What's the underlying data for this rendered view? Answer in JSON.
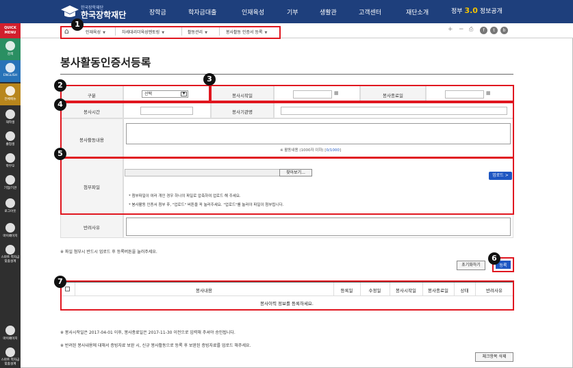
{
  "header": {
    "logo_small": "한국장학재단",
    "logo_text": "한국장학재단",
    "nav": [
      "장학금",
      "학자금대출",
      "인재육성",
      "기부",
      "생활관",
      "고객센터",
      "재단소개"
    ],
    "gov_prefix": "정부",
    "gov_num": "3.0",
    "gov_suffix": "정보공개"
  },
  "sidebar": {
    "quick_menu": "QUICK MENU",
    "items": [
      {
        "label": "검색",
        "icon": "search-icon",
        "color": "#2a8f62"
      },
      {
        "label": "ENGLISH",
        "icon": "globe-icon",
        "color": "#2873b8"
      },
      {
        "label": "전체메뉴",
        "icon": "compass-icon",
        "color": "#b8861c"
      },
      {
        "label": "재학생",
        "icon": "book-icon",
        "color": "#2f2f2f"
      },
      {
        "label": "졸업생",
        "icon": "graduation-cap-icon",
        "color": "#2f2f2f"
      },
      {
        "label": "학부모",
        "icon": "people-icon",
        "color": "#2f2f2f"
      },
      {
        "label": "기업/기관",
        "icon": "building-icon",
        "color": "#2f2f2f"
      },
      {
        "label": "로그아웃",
        "icon": "logout-icon",
        "color": "#2f2f2f"
      },
      {
        "label": "마이페이지",
        "icon": "mypage-icon",
        "color": "#2f2f2f"
      },
      {
        "label": "스마트 학자금 맞춤설계",
        "icon": "smart-icon",
        "color": "#2f2f2f"
      }
    ],
    "bottom": [
      {
        "label": "마이페이지",
        "icon": "mypage-icon"
      },
      {
        "label": "스마트 학자금 맞춤설계",
        "icon": "smart-icon"
      }
    ]
  },
  "breadcrumb": [
    "인재육성",
    "차세대리더육성멘토링",
    "활동관리",
    "봉사활동 인증서 등록"
  ],
  "page_title": "봉사활동인증서등록",
  "form": {
    "type_label": "구분",
    "type_value": "선택",
    "start_label": "봉사시작일",
    "end_label": "봉사종료일",
    "hours_label": "봉사시간",
    "org_label": "봉사기관명",
    "content_label": "봉사활동내용",
    "content_counter_prefix": "※ 활동내용 (1000자 이하) [",
    "content_counter_value": "0/1000",
    "content_counter_suffix": "]",
    "file_label": "첨부파일",
    "browse_button": "찾아보기...",
    "upload_button": "업로드 >",
    "file_note1": "* 첨부파일이 여러 개인 경우 하나의 파일로 압축하여 업로드 해 주세요.",
    "file_note2": "* 봉사활동 인증서 첨부 후, \"업로드\" 버튼을 꼭 눌러주세요. \"업로드\"를 눌러야 파일이 첨부됩니다.",
    "reject_label": "반려사유"
  },
  "upload_notice": "※ 파일 첨부시 반드시 업로드 후 등록버튼을 눌러주세요.",
  "reset_button": "초기화하기",
  "register_button": "등록",
  "list": {
    "headers": [
      "봉사내용",
      "등록일",
      "수정일",
      "봉사시작일",
      "봉사종료일",
      "상태",
      "반려사유"
    ],
    "empty_message": "봉사이력 정보를 등록하세요."
  },
  "footnotes": [
    "※ 봉사시작일은 2017-04-01 이후, 봉사종료일은 2017-11-30 이전으로 입력해 주셔야 승인됩니다.",
    "※ 반려된 봉사내용에 대해서 증빙자료 보완 시, 신규 봉사활동으로 등록 후 보완된 증빙자료를 업로드 해주세요."
  ],
  "delete_button": "체크항목 삭제",
  "annotations": [
    "1",
    "2",
    "3",
    "4",
    "5",
    "6",
    "7"
  ],
  "accent_red": "#e0161f",
  "nav_color": "#1e3f7c",
  "upload_blue": "#1e56c2"
}
